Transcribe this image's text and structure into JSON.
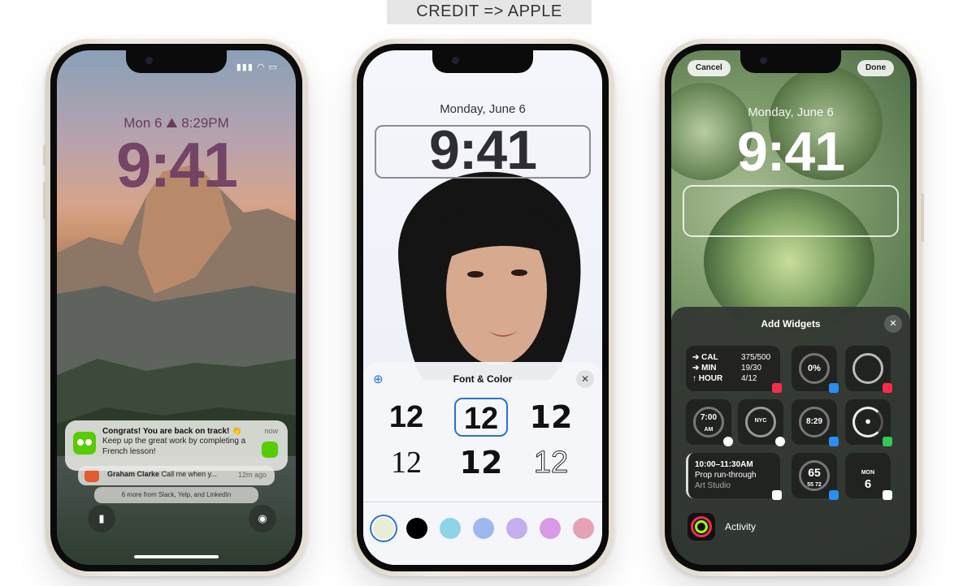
{
  "banner": {
    "credit": "CREDIT => APPLE"
  },
  "phone1": {
    "date_line": "Mon 6  ⛰ 8:29PM",
    "time": "9:41",
    "notification": {
      "title": "Congrats! You are back on track! 👏",
      "body": "Keep up the great work by completing a French lesson!",
      "time": "now"
    },
    "notification2": {
      "sender": "Graham Clarke",
      "message": "Call me when y...",
      "time": "12m ago"
    },
    "notification3": "6 more from Slack, Yelp, and LinkedIn",
    "flashlight_icon": "flashlight-icon",
    "camera_icon": "camera-icon"
  },
  "phone2": {
    "date_line": "Monday, June 6",
    "time": "9:41",
    "sheet_title": "Font & Color",
    "font_options": [
      "12",
      "12",
      "12",
      "12",
      "12",
      "12"
    ],
    "selected_font_index": 1,
    "swatches": [
      "#e8edd8",
      "#000000",
      "#8fd3e6",
      "#9fb7ef",
      "#c3aef0",
      "#d99ae8",
      "#e6a1b7"
    ],
    "selected_swatch_index": 0,
    "accent": "#2a72d4"
  },
  "phone3": {
    "cancel": "Cancel",
    "done": "Done",
    "date_line": "Monday, June 6",
    "time": "9:41",
    "panel_title": "Add Widgets",
    "fitness": [
      {
        "label": "➔ CAL",
        "value": "375/500"
      },
      {
        "label": "➔ MIN",
        "value": "19/30"
      },
      {
        "label": "↑ HOUR",
        "value": "4/12"
      }
    ],
    "weather_pct": "0%",
    "clock_small": "7:00",
    "clock_am": "AM",
    "clock_city": "NYC",
    "alarm_time": "8:29",
    "calendar_event": {
      "time": "10:00–11:30AM",
      "title": "Prop run-through",
      "place": "Art Studio"
    },
    "temp": "65",
    "temp_low": "55",
    "temp_high": "72",
    "cal_day": "MON",
    "cal_date": "6",
    "activity_label": "Activity"
  }
}
